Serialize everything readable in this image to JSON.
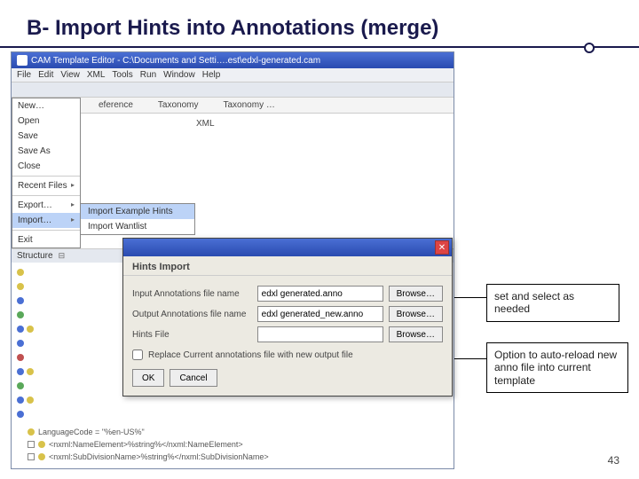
{
  "slide": {
    "title": "B- Import Hints into Annotations (merge)",
    "page_number": "43"
  },
  "window": {
    "title": "CAM Template Editor - C:\\Documents and Setti….est\\edxl-generated.cam"
  },
  "menubar": [
    "File",
    "Edit",
    "View",
    "XML",
    "Tools",
    "Run",
    "Window",
    "Help"
  ],
  "file_menu": {
    "items": [
      "New…",
      "Open",
      "Save",
      "Save As",
      "Close"
    ],
    "recent": "Recent Files",
    "export": "Export…",
    "import": "Import…",
    "exit": "Exit"
  },
  "submenu": {
    "items": [
      "Import Example Hints",
      "Import Wantlist"
    ]
  },
  "tabs": [
    "eference",
    "Taxonomy",
    "Taxonomy …"
  ],
  "xml_label": "XML",
  "structure_label": "Structure",
  "dialog": {
    "header": "Hints Import",
    "rows": {
      "input_label": "Input Annotations file name",
      "input_value": "edxl generated.anno",
      "output_label": "Output Annotations file name",
      "output_value": "edxl generated_new.anno",
      "hints_label": "Hints File",
      "hints_value": ""
    },
    "browse": "Browse…",
    "checkbox_label": "Replace Current annotations file with new output file",
    "ok": "OK",
    "cancel": "Cancel"
  },
  "callouts": {
    "c1": "set and select as needed",
    "c2": "Option to auto-reload new anno file into current template"
  },
  "tree_bottom": {
    "l1": "LanguageCode = \"%en-US%\"",
    "l2": "<nxml:NameElement>%string%</nxml:NameElement>",
    "l3": "<nxml:SubDivisionName>%string%</nxml:SubDivisionName>"
  }
}
